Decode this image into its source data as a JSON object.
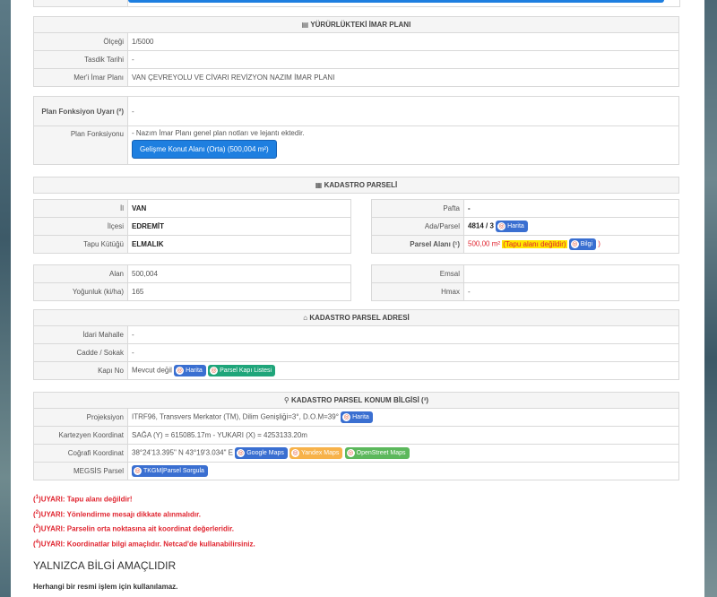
{
  "imar": {
    "header": "YÜRÜRLÜKTEKİ İMAR PLANI",
    "olcegi_label": "Ölçeği",
    "olcegi_value": "1/5000",
    "tasdik_label": "Tasdik Tarihi",
    "tasdik_value": "-",
    "mer_label": "Mer'i İmar Planı",
    "mer_value": "VAN ÇEVREYOLU VE CİVARI REVİZYON NAZIM İMAR PLANI"
  },
  "plan": {
    "uyari_label": "Plan Fonksiyon Uyarı (²)",
    "uyari_value": "-",
    "fonk_label": "Plan Fonksiyonu",
    "fonk_note": "- Nazım İmar Planı genel plan notları ve lejantı ektedir.",
    "fonk_button": "Gelişme Konut Alanı (Orta) (500,004 m²)"
  },
  "kadastro": {
    "header": "KADASTRO PARSELİ",
    "il_label": "İl",
    "il_value": "VAN",
    "ilce_label": "İlçesi",
    "ilce_value": "EDREMİT",
    "tapu_label": "Tapu Kütüğü",
    "tapu_value": "ELMALIK",
    "pafta_label": "Pafta",
    "pafta_value": "-",
    "ada_label": "Ada/Parsel",
    "ada_value": "4814 / 3",
    "ada_button": "Harita",
    "alan_label": "Parsel Alanı (¹)",
    "alan_value": "500,00 m²",
    "alan_warn": "(Tapu alanı değildir)",
    "alan_button": "Bilgi",
    "alan_close": ")",
    "alan2_label": "Alan",
    "alan2_value": "500,004",
    "yog_label": "Yoğunluk (ki/ha)",
    "yog_value": "165",
    "emsal_label": "Emsal",
    "emsal_value": "",
    "hmax_label": "Hmax",
    "hmax_value": "-"
  },
  "adres": {
    "header": "KADASTRO PARSEL ADRESİ",
    "idari_label": "İdari Mahalle",
    "idari_value": "-",
    "cadde_label": "Cadde / Sokak",
    "cadde_value": "-",
    "kapi_label": "Kapı No",
    "kapi_value": "Mevcut değil",
    "kapi_btn1": "Harita",
    "kapi_btn2": "Parsel Kapı Listesi"
  },
  "konum": {
    "header": "KADASTRO PARSEL KONUM BİLGİSİ (³)",
    "proj_label": "Projeksiyon",
    "proj_value": "ITRF96, Transvers Merkator (TM), Dilim Genişliği=3°, D.O.M=39°",
    "proj_btn": "Harita",
    "kart_label": "Kartezyen Koordinat",
    "kart_value": "SAĞA (Y) = 615085.17m - YUKARI (X) = 4253133.20m",
    "cog_label": "Coğrafi Koordinat",
    "cog_value": "38°24'13.395\" N 43°19'3.034\" E",
    "cog_btn1": "Google Maps",
    "cog_btn2": "Yandex Maps",
    "cog_btn3": "OpenStreet Maps",
    "megsis_label": "MEGSİS Parsel",
    "megsis_btn": "TKGM|Parsel Sorgula"
  },
  "notes": [
    {
      "sup": "1",
      "text": "UYARI: Tapu alanı değildir!"
    },
    {
      "sup": "2",
      "text": "UYARI: Yönlendirme mesajı dikkate alınmalıdır."
    },
    {
      "sup": "3",
      "text": "UYARI: Parselin orta noktasına ait koordinat değerleridir."
    },
    {
      "sup": "4",
      "text": "UYARI: Koordinatlar bilgi amaçlıdır. Netcad'de kullanabilirsiniz."
    }
  ],
  "footer": {
    "title": "YALNIZCA BİLGİ AMAÇLIDIR",
    "subtitle": "Herhangi bir resmi işlem için kullanılamaz."
  },
  "colors": {
    "accent": "#1e7fe0",
    "warning": "#e0242f",
    "highlight": "#ffe600"
  },
  "icons": [
    "document-icon",
    "grid-icon",
    "home-icon",
    "map-pin-icon",
    "map-search-icon"
  ]
}
